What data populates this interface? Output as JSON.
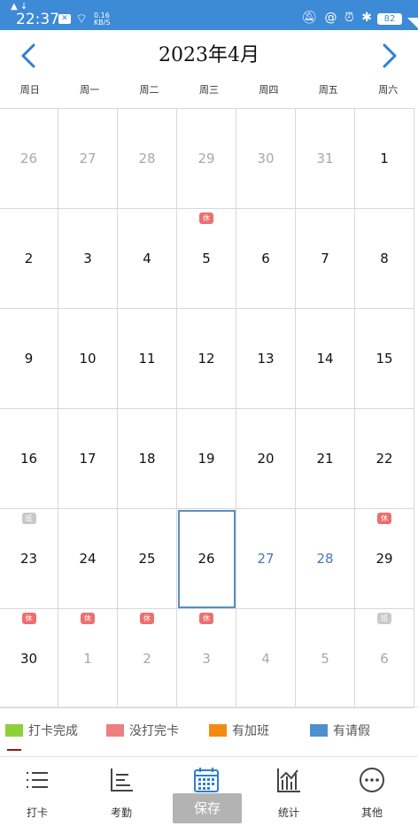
{
  "status_bar": {
    "time": "22:37",
    "tiny_left": "▲ ↓",
    "network_speed_value": "0.16",
    "network_speed_unit": "KB/S",
    "battery": "82",
    "icons": [
      "notification-off-icon",
      "at-icon",
      "alarm-icon",
      "bluetooth-icon"
    ]
  },
  "header": {
    "title": "2023年4月",
    "prev_icon": "chevron-left-icon",
    "next_icon": "chevron-right-icon"
  },
  "weekdays": [
    "周日",
    "周一",
    "周二",
    "周三",
    "周四",
    "周五",
    "周六"
  ],
  "calendar": {
    "weeks": [
      [
        {
          "day": "26",
          "type": "other"
        },
        {
          "day": "27",
          "type": "other"
        },
        {
          "day": "28",
          "type": "other"
        },
        {
          "day": "29",
          "type": "other"
        },
        {
          "day": "30",
          "type": "other"
        },
        {
          "day": "31",
          "type": "other"
        },
        {
          "day": "1",
          "type": "current"
        }
      ],
      [
        {
          "day": "2",
          "type": "current"
        },
        {
          "day": "3",
          "type": "current"
        },
        {
          "day": "4",
          "type": "current"
        },
        {
          "day": "5",
          "type": "current",
          "badge": "休",
          "badge_color": "red"
        },
        {
          "day": "6",
          "type": "current"
        },
        {
          "day": "7",
          "type": "current"
        },
        {
          "day": "8",
          "type": "current"
        }
      ],
      [
        {
          "day": "9",
          "type": "current"
        },
        {
          "day": "10",
          "type": "current"
        },
        {
          "day": "11",
          "type": "current"
        },
        {
          "day": "12",
          "type": "current"
        },
        {
          "day": "13",
          "type": "current"
        },
        {
          "day": "14",
          "type": "current"
        },
        {
          "day": "15",
          "type": "current"
        }
      ],
      [
        {
          "day": "16",
          "type": "current"
        },
        {
          "day": "17",
          "type": "current"
        },
        {
          "day": "18",
          "type": "current"
        },
        {
          "day": "19",
          "type": "current"
        },
        {
          "day": "20",
          "type": "current"
        },
        {
          "day": "21",
          "type": "current"
        },
        {
          "day": "22",
          "type": "current"
        }
      ],
      [
        {
          "day": "23",
          "type": "current",
          "badge": "班",
          "badge_color": "gray"
        },
        {
          "day": "24",
          "type": "current"
        },
        {
          "day": "25",
          "type": "current"
        },
        {
          "day": "26",
          "type": "current",
          "selected": true
        },
        {
          "day": "27",
          "type": "future"
        },
        {
          "day": "28",
          "type": "future"
        },
        {
          "day": "29",
          "type": "current",
          "badge": "休",
          "badge_color": "red"
        }
      ],
      [
        {
          "day": "30",
          "type": "current",
          "badge": "休",
          "badge_color": "red"
        },
        {
          "day": "1",
          "type": "other",
          "badge": "休",
          "badge_color": "red"
        },
        {
          "day": "2",
          "type": "other",
          "badge": "休",
          "badge_color": "red"
        },
        {
          "day": "3",
          "type": "other",
          "badge": "休",
          "badge_color": "red"
        },
        {
          "day": "4",
          "type": "other"
        },
        {
          "day": "5",
          "type": "other"
        },
        {
          "day": "6",
          "type": "other",
          "badge": "班",
          "badge_color": "gray"
        }
      ]
    ]
  },
  "legend": [
    {
      "label": "打卡完成",
      "color": "#8ecf3a"
    },
    {
      "label": "没打完卡",
      "color": "#ec7f7f"
    },
    {
      "label": "有加班",
      "color": "#f38b12"
    },
    {
      "label": "有请假",
      "color": "#4f8fcf"
    }
  ],
  "bottom_nav": [
    {
      "label": "打卡",
      "icon": "list-icon"
    },
    {
      "label": "考勤",
      "icon": "attendance-icon"
    },
    {
      "label": "保存",
      "icon": "calendar-icon"
    },
    {
      "label": "统计",
      "icon": "chart-icon"
    },
    {
      "label": "其他",
      "icon": "more-icon"
    }
  ]
}
